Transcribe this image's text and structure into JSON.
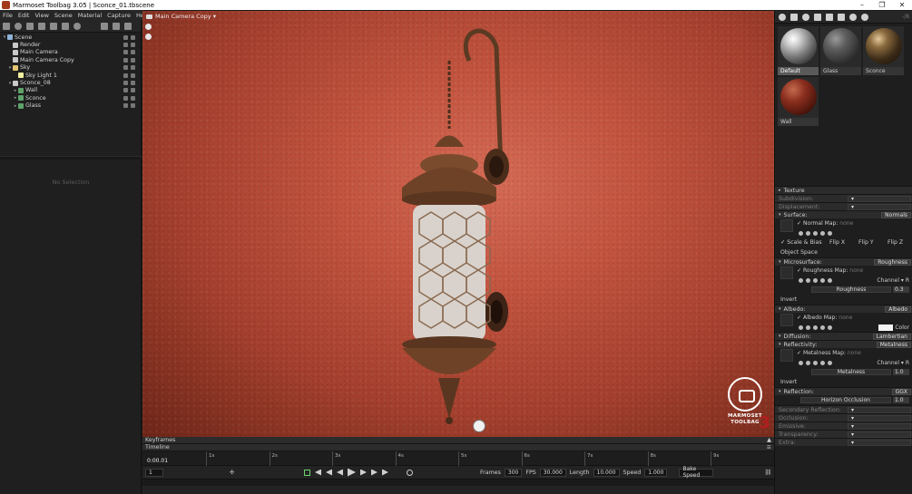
{
  "window": {
    "title": "Marmoset Toolbag 3.05 | Sconce_01.tbscene",
    "buttons": [
      "–",
      "❐",
      "✕"
    ]
  },
  "menu": [
    "File",
    "Edit",
    "View",
    "Scene",
    "Material",
    "Capture",
    "Help"
  ],
  "scene_tree": {
    "items": [
      {
        "label": "Scene",
        "indent": 0,
        "expander": "▾",
        "icon_color": "#8fb3d9"
      },
      {
        "label": "Render",
        "indent": 1,
        "expander": "",
        "icon_color": "#c9c9c9"
      },
      {
        "label": "Main Camera",
        "indent": 1,
        "expander": "",
        "icon_color": "#c9c9c9"
      },
      {
        "label": "Main Camera Copy",
        "indent": 1,
        "expander": "",
        "icon_color": "#c9c9c9"
      },
      {
        "label": "Sky",
        "indent": 1,
        "expander": "▾",
        "icon_color": "#e2c572"
      },
      {
        "label": "Sky Light 1",
        "indent": 2,
        "expander": "",
        "icon_color": "#f0f0a0"
      },
      {
        "label": "Sconce_08",
        "indent": 1,
        "expander": "▾",
        "icon_color": "#c9c9c9"
      },
      {
        "label": "Wall",
        "indent": 2,
        "expander": "▸",
        "icon_color": "#5fa36b"
      },
      {
        "label": "Sconce",
        "indent": 2,
        "expander": "▸",
        "icon_color": "#5fa36b"
      },
      {
        "label": "Glass",
        "indent": 2,
        "expander": "▸",
        "icon_color": "#5fa36b"
      }
    ],
    "no_selection": "No Selection"
  },
  "viewport": {
    "camera_label": "Main Camera Copy ▾",
    "logo_line1": "MARMOSET",
    "logo_line2": "TOOLBAG",
    "logo_version": "3"
  },
  "timeline": {
    "keyframes_label": "Keyframes",
    "timeline_label": "Timeline",
    "current_time": "0:00.01",
    "frame_field": "1",
    "ticks": [
      "1s",
      "2s",
      "3s",
      "4s",
      "5s",
      "6s",
      "7s",
      "8s",
      "9s"
    ],
    "frames_label": "Frames",
    "frames_value": "300",
    "fps_label": "FPS",
    "fps_value": "30.000",
    "length_label": "Length",
    "length_value": "10.000",
    "speed_label": "Speed",
    "speed_value": "1.000",
    "bake_speed": "Bake Speed",
    "end_frame": "300"
  },
  "materials": {
    "version_hint": "-/8",
    "items": [
      {
        "label": "Default",
        "ball": "radial-gradient(circle at 35% 30%, #ffffff 0%, #cfcfcf 20%, #7d7d7d 50%, #2a2a2a 85%)",
        "selected": true
      },
      {
        "label": "Glass",
        "ball": "radial-gradient(circle at 35% 30%, #9a9a9a 0%, #5e5e5e 30%, #2f2f2f 70%, #141414 100%)",
        "selected": false
      },
      {
        "label": "Sconce",
        "ball": "radial-gradient(circle at 35% 30%, #e3c89a 0%, #8a6a3e 25%, #3b2a17 60%, #151008 100%)",
        "selected": false
      },
      {
        "label": "Wall",
        "ball": "radial-gradient(circle at 35% 30%, #c46a4e 0%, #8a2e1e 35%, #4a140b 75%, #200704 100%)",
        "selected": false
      }
    ]
  },
  "properties": {
    "texture": "Texture",
    "subdivision": "Subdivision:",
    "displacement": "Displacement:",
    "surface": "Surface:",
    "surface_mode": "Normals",
    "normal_map": "Normal Map:",
    "none": "none",
    "scale_bias": "Scale & Bias",
    "flip_x": "Flip X",
    "flip_y": "Flip Y",
    "flip_z": "Flip Z",
    "object_space": "Object Space",
    "microsurface": "Microsurface:",
    "microsurface_mode": "Roughness",
    "roughness_map": "Roughness Map:",
    "channel": "Channel ▾ R",
    "roughness": "Roughness",
    "roughness_value": "0.3",
    "invert": "Invert",
    "albedo": "Albedo:",
    "albedo_mode": "Albedo",
    "albedo_map": "Albedo Map:",
    "color": "Color",
    "diffusion": "Diffusion:",
    "diffusion_mode": "Lambertian",
    "reflectivity": "Reflectivity:",
    "reflectivity_mode": "Metalness",
    "metalness_map": "Metalness Map:",
    "metalness": "Metalness",
    "metalness_value": "1.0",
    "reflection": "Reflection:",
    "reflection_mode": "GGX",
    "horizon_occlusion": "Horizon Occlusion",
    "horizon_value": "1.0",
    "secondary_reflection": "Secondary Reflection:",
    "occlusion": "Occlusion:",
    "emissive": "Emissive:",
    "transparency": "Transparency:",
    "extra": "Extra:"
  }
}
